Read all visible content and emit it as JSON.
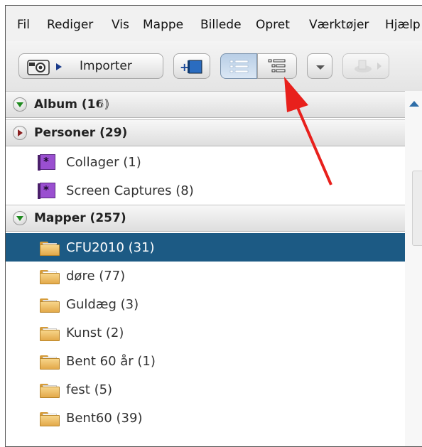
{
  "menu": [
    "Fil",
    "Rediger",
    "Vis",
    "Mappe",
    "Billede",
    "Opret",
    "Værktøjer",
    "Hjælp"
  ],
  "toolbar": {
    "import_label": "Importer"
  },
  "sections": {
    "album": {
      "label": "Album (16)",
      "ghost": "3)"
    },
    "personer": {
      "label": "Personer (29)"
    },
    "mapper": {
      "label": "Mapper (257)"
    }
  },
  "albums": [
    {
      "label": "Collager (1)"
    },
    {
      "label": "Screen Captures (8)"
    }
  ],
  "folders": [
    {
      "label": "CFU2010 (31)",
      "selected": true
    },
    {
      "label": "døre (77)"
    },
    {
      "label": "Guldæg (3)"
    },
    {
      "label": "Kunst (2)"
    },
    {
      "label": "Bent 60 år (1)"
    },
    {
      "label": "fest (5)"
    },
    {
      "label": "Bent60 (39)"
    }
  ],
  "colors": {
    "selection": "#1c5a84",
    "arrow": "#e8201c"
  },
  "icons": [
    "camera-icon",
    "add-album-icon",
    "list-view-icon",
    "tree-view-icon",
    "dropdown-icon",
    "share-icon",
    "album-icon",
    "folder-icon"
  ]
}
